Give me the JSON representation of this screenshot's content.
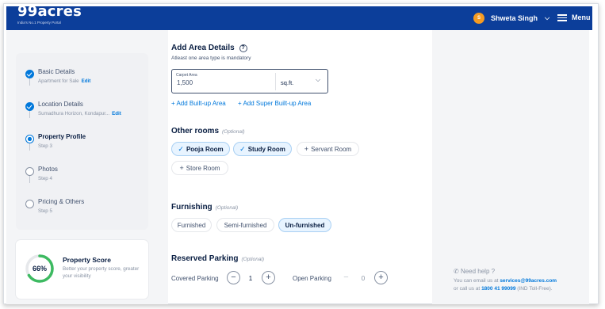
{
  "header": {
    "logo": "99acres",
    "tagline": "India's No.1 Property Portal",
    "user_initial": "S",
    "user_name": "Shweta Singh",
    "menu_label": "Menu",
    "bg_color": "#0c3e9a"
  },
  "steps": [
    {
      "title": "Basic Details",
      "sub": "Apartment for Sale",
      "edit": "Edit",
      "state": "done"
    },
    {
      "title": "Location Details",
      "sub": "Sumadhura Horizon, Kondapur...",
      "edit": "Edit",
      "state": "done"
    },
    {
      "title": "Property Profile",
      "sub": "Step 3",
      "state": "current"
    },
    {
      "title": "Photos",
      "sub": "Step 4",
      "state": "todo"
    },
    {
      "title": "Pricing & Others",
      "sub": "Step 5",
      "state": "todo"
    }
  ],
  "score": {
    "percent": 66,
    "percent_label": "66%",
    "title": "Property Score",
    "desc": "Better your property score, greater your visibility",
    "ring_color": "#3dba61"
  },
  "area": {
    "title": "Add Area Details",
    "help_icon": "question-circle-icon",
    "hint": "Atleast one area type is mandatory",
    "field_label": "Carpet Area",
    "field_value": "1,500",
    "unit": "sq.ft.",
    "add_builtup": "+ Add Built-up Area",
    "add_super": "+ Add Super Built-up Area"
  },
  "other_rooms": {
    "title": "Other rooms",
    "optional": "(Optional)",
    "chips": [
      {
        "label": "Pooja Room",
        "selected": true
      },
      {
        "label": "Study Room",
        "selected": true
      },
      {
        "label": "Servant Room",
        "selected": false
      },
      {
        "label": "Store Room",
        "selected": false
      }
    ]
  },
  "furnishing": {
    "title": "Furnishing",
    "optional": "(Optional)",
    "chips": [
      {
        "label": "Furnished",
        "selected": false
      },
      {
        "label": "Semi-furnished",
        "selected": false
      },
      {
        "label": "Un-furnished",
        "selected": true
      }
    ]
  },
  "parking": {
    "title": "Reserved Parking",
    "optional": "(Optional)",
    "covered_label": "Covered Parking",
    "covered_value": "1",
    "open_label": "Open Parking",
    "open_value": "0",
    "minus": "−",
    "plus": "+"
  },
  "help": {
    "title": "Need help ?",
    "line1_prefix": "You can email us at",
    "email": "services@99acres.com",
    "line2_prefix": "or call us at",
    "phone": "1800 41 99099",
    "line2_suffix": "(IND Toll-Free)."
  },
  "colors": {
    "accent": "#0078db",
    "selected_chip_bg": "#e8f4ff"
  }
}
